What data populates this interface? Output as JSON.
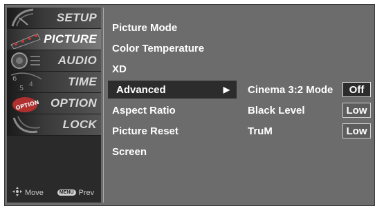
{
  "tabs": [
    {
      "id": "setup",
      "label": "SETUP",
      "icon": "satellite-dish-icon",
      "selected": false
    },
    {
      "id": "picture",
      "label": "PICTURE",
      "icon": "film-reel-icon",
      "selected": true
    },
    {
      "id": "audio",
      "label": "AUDIO",
      "icon": "speaker-icon",
      "selected": false
    },
    {
      "id": "time",
      "label": "TIME",
      "icon": "clock-icon",
      "selected": false
    },
    {
      "id": "option",
      "label": "OPTION",
      "icon": "option-badge-icon",
      "selected": false
    },
    {
      "id": "lock",
      "label": "LOCK",
      "icon": "lock-icon",
      "selected": false
    }
  ],
  "hints": {
    "move_label": "Move",
    "menu_key": "MENU",
    "prev_label": "Prev"
  },
  "menu": {
    "items": [
      {
        "label": "Picture Mode",
        "selected": false
      },
      {
        "label": "Color Temperature",
        "selected": false
      },
      {
        "label": "XD",
        "selected": false
      },
      {
        "label": "Advanced",
        "selected": true,
        "arrow": "▶"
      },
      {
        "label": "Aspect Ratio",
        "selected": false
      },
      {
        "label": "Picture Reset",
        "selected": false
      },
      {
        "label": "Screen",
        "selected": false
      }
    ]
  },
  "submenu": {
    "rows": [
      {
        "label": "Cinema 3:2 Mode",
        "value": "Off",
        "selected": true
      },
      {
        "label": "Black Level",
        "value": "Low",
        "selected": false
      },
      {
        "label": "TruM",
        "value": "Low",
        "selected": false
      }
    ]
  },
  "colors": {
    "panel": "#6c6c6c",
    "selected_bg": "#2c2c2c",
    "text": "#ffffff"
  }
}
